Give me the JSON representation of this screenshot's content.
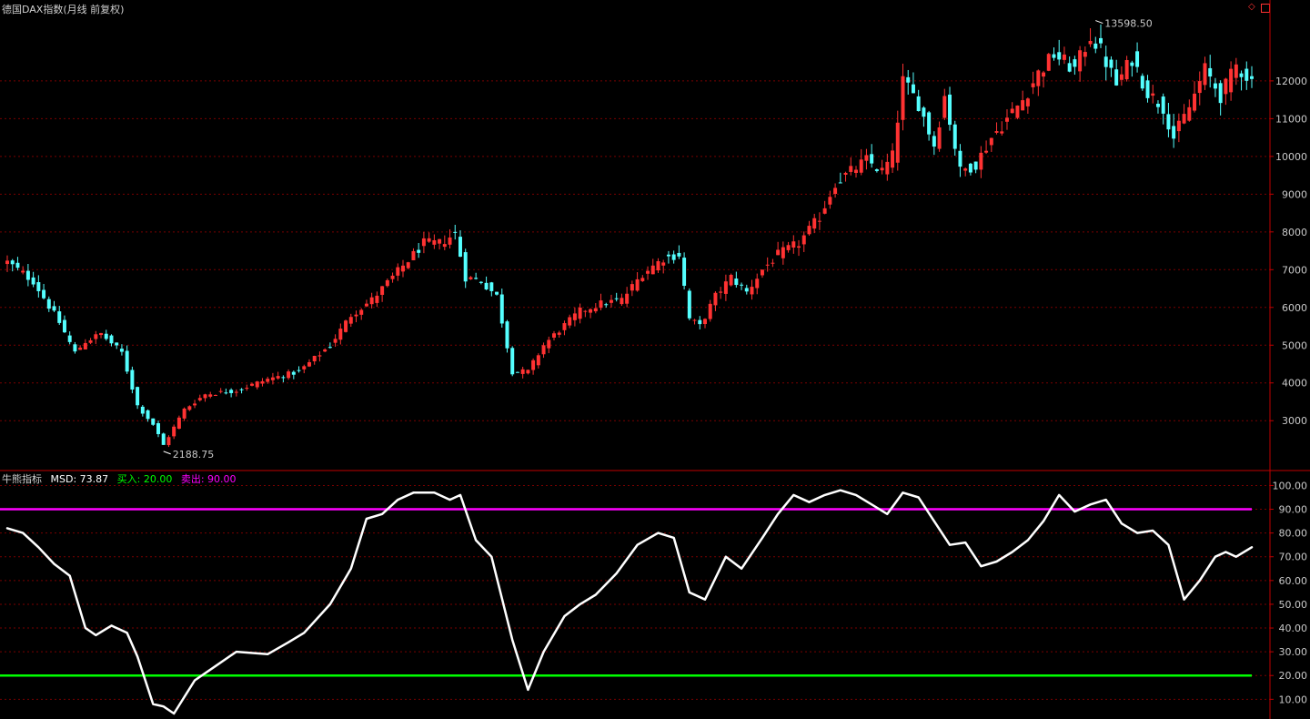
{
  "title": "德国DAX指数(月线 前复权)",
  "indicator": {
    "name": "牛熊指标",
    "msd_label": "MSD: 73.87",
    "buy_label": "买入: 20.00",
    "sell_label": "卖出: 90.00"
  },
  "colors": {
    "background": "#000000",
    "up_candle": "#ff3232",
    "down_candle": "#54ffff",
    "axis": "#c00000",
    "grid": "#7a0000",
    "msd_line": "#ffffff",
    "buy_line": "#00ff00",
    "sell_line": "#ff00ff",
    "axis_text": "#c8c8c8"
  },
  "icons": [
    "diamond-icon",
    "panel-icon"
  ],
  "chart_data": [
    {
      "type": "candlestick",
      "ylim": [
        1800,
        13950
      ],
      "yticks": [
        3000,
        4000,
        5000,
        6000,
        7000,
        8000,
        9000,
        10000,
        11000,
        12000
      ],
      "ytick_labels": [
        "3000",
        "4000",
        "5000",
        "6000",
        "7000",
        "8000",
        "9000",
        "10000",
        "11000",
        "12000"
      ],
      "annotations": [
        {
          "text": "13598.50",
          "value": 13598.5,
          "at_index": 209
        },
        {
          "text": "2188.75",
          "value": 2188.75,
          "at_index": 30
        }
      ],
      "waypoints": [
        [
          0,
          7200
        ],
        [
          5,
          6700
        ],
        [
          10,
          5600
        ],
        [
          13,
          4800
        ],
        [
          15,
          5100
        ],
        [
          18,
          5300
        ],
        [
          22,
          4800
        ],
        [
          25,
          3400
        ],
        [
          28,
          2900
        ],
        [
          30,
          2350
        ],
        [
          34,
          3300
        ],
        [
          38,
          3700
        ],
        [
          44,
          3800
        ],
        [
          50,
          4100
        ],
        [
          56,
          4300
        ],
        [
          62,
          5000
        ],
        [
          66,
          5800
        ],
        [
          70,
          6200
        ],
        [
          76,
          7100
        ],
        [
          80,
          7700
        ],
        [
          83,
          7700
        ],
        [
          86,
          7950
        ],
        [
          88,
          6800
        ],
        [
          91,
          6700
        ],
        [
          94,
          6300
        ],
        [
          97,
          4300
        ],
        [
          100,
          4300
        ],
        [
          103,
          5000
        ],
        [
          106,
          5400
        ],
        [
          110,
          5900
        ],
        [
          114,
          6100
        ],
        [
          118,
          6200
        ],
        [
          122,
          6900
        ],
        [
          126,
          7300
        ],
        [
          129,
          7400
        ],
        [
          131,
          5700
        ],
        [
          133,
          5500
        ],
        [
          136,
          6300
        ],
        [
          139,
          6800
        ],
        [
          142,
          6400
        ],
        [
          145,
          7000
        ],
        [
          148,
          7400
        ],
        [
          152,
          7700
        ],
        [
          156,
          8400
        ],
        [
          159,
          9300
        ],
        [
          162,
          9600
        ],
        [
          165,
          9900
        ],
        [
          168,
          9600
        ],
        [
          170,
          10000
        ],
        [
          172,
          12000
        ],
        [
          175,
          11400
        ],
        [
          178,
          10300
        ],
        [
          180,
          11600
        ],
        [
          183,
          9600
        ],
        [
          186,
          9800
        ],
        [
          189,
          10500
        ],
        [
          192,
          11000
        ],
        [
          195,
          11500
        ],
        [
          198,
          12200
        ],
        [
          201,
          12700
        ],
        [
          205,
          12300
        ],
        [
          208,
          13200
        ],
        [
          210,
          12800
        ],
        [
          213,
          11900
        ],
        [
          216,
          12600
        ],
        [
          219,
          11700
        ],
        [
          222,
          11300
        ],
        [
          224,
          10500
        ],
        [
          227,
          11300
        ],
        [
          230,
          12300
        ],
        [
          233,
          11600
        ],
        [
          236,
          12400
        ],
        [
          239,
          12000
        ]
      ]
    },
    {
      "type": "line",
      "ylim": [
        4,
        104
      ],
      "yticks": [
        10,
        20,
        30,
        40,
        50,
        60,
        70,
        80,
        90,
        100
      ],
      "ytick_labels": [
        "10.00",
        "20.00",
        "30.00",
        "40.00",
        "50.00",
        "60.00",
        "70.00",
        "80.00",
        "90.00",
        "100.00"
      ],
      "series": [
        {
          "name": "MSD",
          "points": [
            [
              0,
              82
            ],
            [
              3,
              80
            ],
            [
              6,
              74
            ],
            [
              9,
              67
            ],
            [
              12,
              62
            ],
            [
              15,
              40
            ],
            [
              17,
              37
            ],
            [
              20,
              41
            ],
            [
              23,
              38
            ],
            [
              25,
              28
            ],
            [
              28,
              8
            ],
            [
              30,
              7
            ],
            [
              32,
              4
            ],
            [
              36,
              18
            ],
            [
              40,
              24
            ],
            [
              44,
              30
            ],
            [
              50,
              29
            ],
            [
              54,
              34
            ],
            [
              57,
              38
            ],
            [
              62,
              50
            ],
            [
              66,
              65
            ],
            [
              69,
              86
            ],
            [
              72,
              88
            ],
            [
              75,
              94
            ],
            [
              78,
              97
            ],
            [
              82,
              97
            ],
            [
              85,
              94
            ],
            [
              87,
              96
            ],
            [
              90,
              77
            ],
            [
              93,
              70
            ],
            [
              97,
              35
            ],
            [
              100,
              14
            ],
            [
              103,
              30
            ],
            [
              107,
              45
            ],
            [
              110,
              50
            ],
            [
              113,
              54
            ],
            [
              117,
              63
            ],
            [
              121,
              75
            ],
            [
              125,
              80
            ],
            [
              128,
              78
            ],
            [
              131,
              55
            ],
            [
              134,
              52
            ],
            [
              138,
              70
            ],
            [
              141,
              65
            ],
            [
              145,
              78
            ],
            [
              148,
              88
            ],
            [
              151,
              96
            ],
            [
              154,
              93
            ],
            [
              157,
              96
            ],
            [
              160,
              98
            ],
            [
              163,
              96
            ],
            [
              166,
              92
            ],
            [
              169,
              88
            ],
            [
              172,
              97
            ],
            [
              175,
              95
            ],
            [
              178,
              85
            ],
            [
              181,
              75
            ],
            [
              184,
              76
            ],
            [
              187,
              66
            ],
            [
              190,
              68
            ],
            [
              193,
              72
            ],
            [
              196,
              77
            ],
            [
              199,
              85
            ],
            [
              202,
              96
            ],
            [
              205,
              89
            ],
            [
              208,
              92
            ],
            [
              211,
              94
            ],
            [
              214,
              84
            ],
            [
              217,
              80
            ],
            [
              220,
              81
            ],
            [
              223,
              75
            ],
            [
              226,
              52
            ],
            [
              229,
              60
            ],
            [
              232,
              70
            ],
            [
              234,
              72
            ],
            [
              236,
              70
            ],
            [
              239,
              74
            ]
          ]
        },
        {
          "name": "买入",
          "value": 20
        },
        {
          "name": "卖出",
          "value": 90
        }
      ]
    }
  ]
}
